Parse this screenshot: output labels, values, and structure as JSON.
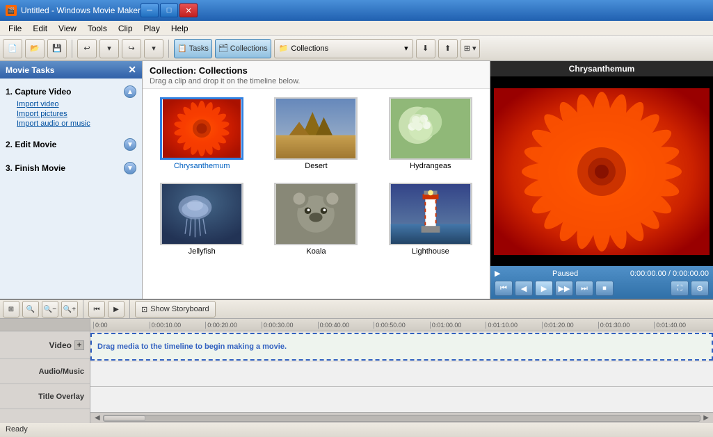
{
  "titlebar": {
    "title": "Untitled - Windows Movie Maker",
    "icon": "🎬"
  },
  "menubar": {
    "items": [
      "File",
      "Edit",
      "View",
      "Tools",
      "Clip",
      "Play",
      "Help"
    ]
  },
  "toolbar": {
    "new_label": "📄",
    "open_label": "📂",
    "save_label": "💾",
    "undo_label": "↩",
    "redo_label": "↪",
    "tasks_label": "Tasks",
    "collections_tab_label": "Collections",
    "collections_dropdown_label": "Collections"
  },
  "tasks_panel": {
    "header": "Movie Tasks",
    "sections": [
      {
        "id": "capture",
        "title": "1.  Capture Video",
        "links": [
          "Import video",
          "Import pictures",
          "Import audio or music"
        ]
      },
      {
        "id": "edit",
        "title": "2.  Edit Movie",
        "links": []
      },
      {
        "id": "finish",
        "title": "3.  Finish Movie",
        "links": []
      }
    ]
  },
  "collection": {
    "title": "Collection: Collections",
    "subtitle": "Drag a clip and drop it on the timeline below.",
    "items": [
      {
        "id": "chrysanthemum",
        "label": "Chrysanthemum",
        "selected": true,
        "thumb_type": "chrysanthemum"
      },
      {
        "id": "desert",
        "label": "Desert",
        "selected": false,
        "thumb_type": "desert"
      },
      {
        "id": "hydrangeas",
        "label": "Hydrangeas",
        "selected": false,
        "thumb_type": "hydrangeas"
      },
      {
        "id": "jellyfish",
        "label": "Jellyfish",
        "selected": false,
        "thumb_type": "jellyfish"
      },
      {
        "id": "koala",
        "label": "Koala",
        "selected": false,
        "thumb_type": "koala"
      },
      {
        "id": "lighthouse",
        "label": "Lighthouse",
        "selected": false,
        "thumb_type": "lighthouse"
      }
    ]
  },
  "preview": {
    "title": "Chrysanthemum",
    "status": "Paused",
    "time_current": "0:00:00.00",
    "time_total": "0:00:00.00"
  },
  "timeline": {
    "storyboard_btn": "Show Storyboard",
    "tracks": [
      "Video",
      "Audio/Music",
      "Title Overlay"
    ],
    "drop_hint": "Drag media to the timeline to begin making a movie.",
    "ruler_ticks": [
      "0:00",
      "0:00:10.00",
      "0:00:20.00",
      "0:00:30.00",
      "0:00:40.00",
      "0:00:50.00",
      "0:01:00.00",
      "0:01:10.00",
      "0:01:20.00",
      "0:01:30.00",
      "0:01:40.00"
    ]
  },
  "statusbar": {
    "status": "Ready"
  }
}
